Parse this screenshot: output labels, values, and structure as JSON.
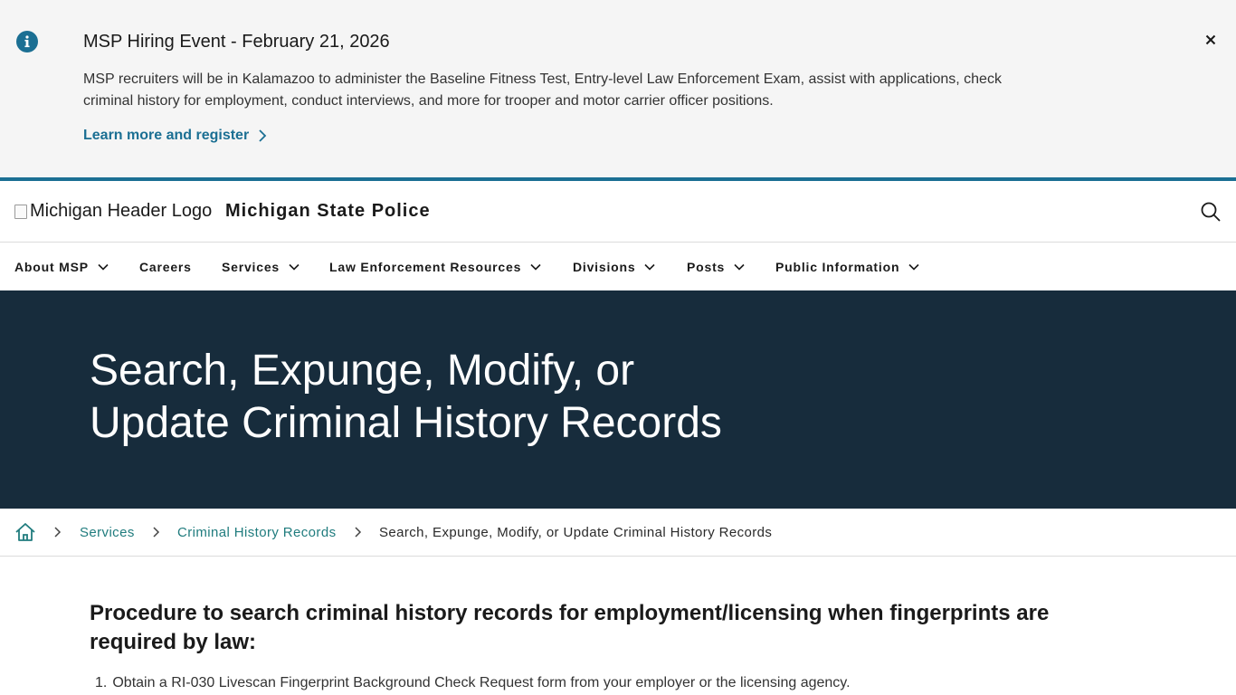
{
  "alert": {
    "icon": "info-icon",
    "title": "MSP Hiring Event - February 21, 2026",
    "body": "MSP recruiters will be in Kalamazoo to administer the Baseline Fitness Test, Entry-level Law Enforcement Exam, assist with applications, check criminal history for employment, conduct interviews, and more for trooper and motor carrier officer positions.",
    "link_label": "Learn more and register",
    "close_icon": "close-icon"
  },
  "header": {
    "logo_alt": "Michigan Header Logo",
    "site_title": "Michigan State Police",
    "search_icon": "search-icon"
  },
  "nav": {
    "items": [
      {
        "label": "About MSP",
        "has_dropdown": true
      },
      {
        "label": "Careers",
        "has_dropdown": false
      },
      {
        "label": "Services",
        "has_dropdown": true
      },
      {
        "label": "Law Enforcement Resources",
        "has_dropdown": true
      },
      {
        "label": "Divisions",
        "has_dropdown": true
      },
      {
        "label": "Posts",
        "has_dropdown": true
      },
      {
        "label": "Public Information",
        "has_dropdown": true
      }
    ]
  },
  "hero": {
    "title_line1": "Search, Expunge, Modify, or",
    "title_line2": "Update Criminal History Records"
  },
  "breadcrumb": {
    "home_icon": "home-icon",
    "items": [
      {
        "label": "Services"
      },
      {
        "label": "Criminal History Records"
      }
    ],
    "current": "Search, Expunge, Modify, or Update Criminal History Records"
  },
  "content": {
    "heading": "Procedure to search criminal history records for employment/licensing when fingerprints are required by law:",
    "steps": [
      {
        "number": "1.",
        "text": "Obtain a RI-030 Livescan Fingerprint Background Check Request form from your employer or the licensing agency."
      }
    ]
  },
  "colors": {
    "accent": "#1b6f93",
    "hero_bg": "#172c3c",
    "link_green": "#207c7e",
    "alert_bg": "#f5f5f5"
  }
}
